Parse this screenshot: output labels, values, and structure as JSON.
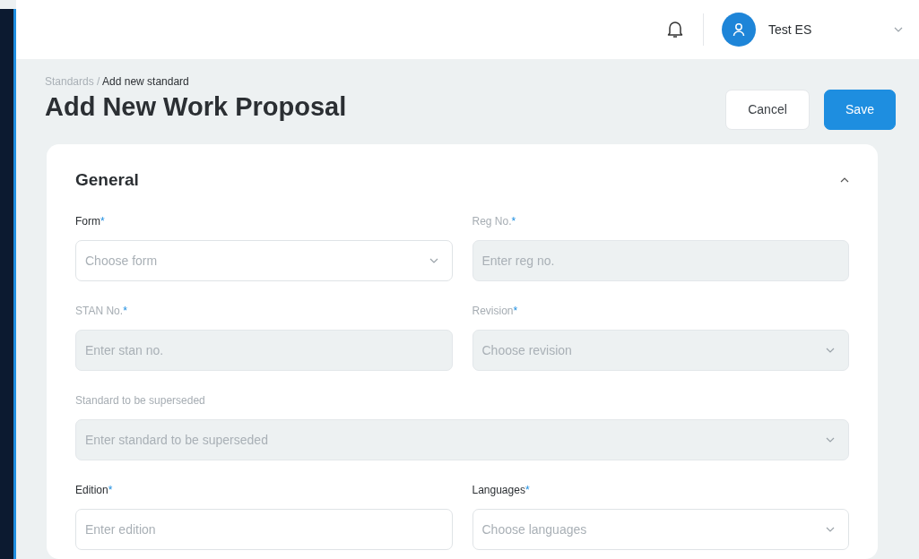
{
  "header": {
    "user_name": "Test ES"
  },
  "breadcrumb": [
    {
      "label": "Standards",
      "current": false
    },
    {
      "label": "Add new standard",
      "current": true
    }
  ],
  "breadcrumb_separator": "/",
  "title": "Add New Work Proposal",
  "buttons": [
    {
      "label": "Cancel",
      "kind": "secondary"
    },
    {
      "label": "Save",
      "kind": "primary"
    }
  ],
  "section": {
    "title": "General",
    "expanded": true,
    "rows": [
      {
        "fields": [
          {
            "label": "Form",
            "required_mark": "*",
            "kind": "select",
            "disabled": false,
            "placeholder": "Choose form"
          },
          {
            "label": "Reg No.",
            "required_mark": "*",
            "kind": "text",
            "disabled": true,
            "placeholder": "Enter reg no."
          }
        ]
      },
      {
        "fields": [
          {
            "label": "STAN No.",
            "required_mark": "*",
            "kind": "text",
            "disabled": true,
            "placeholder": "Enter stan no."
          },
          {
            "label": "Revision",
            "required_mark": "*",
            "kind": "select",
            "disabled": true,
            "placeholder": "Choose revision"
          }
        ]
      },
      {
        "fields": [
          {
            "label": "Standard to be superseded",
            "kind": "select",
            "disabled": true,
            "placeholder": "Enter standard to be superseded"
          }
        ]
      },
      {
        "fields": [
          {
            "label": "Edition",
            "required_mark": "*",
            "kind": "text",
            "disabled": false,
            "placeholder": "Enter edition"
          },
          {
            "label": "Languages",
            "required_mark": "*",
            "kind": "select",
            "disabled": false,
            "placeholder": "Choose languages"
          }
        ]
      }
    ]
  }
}
